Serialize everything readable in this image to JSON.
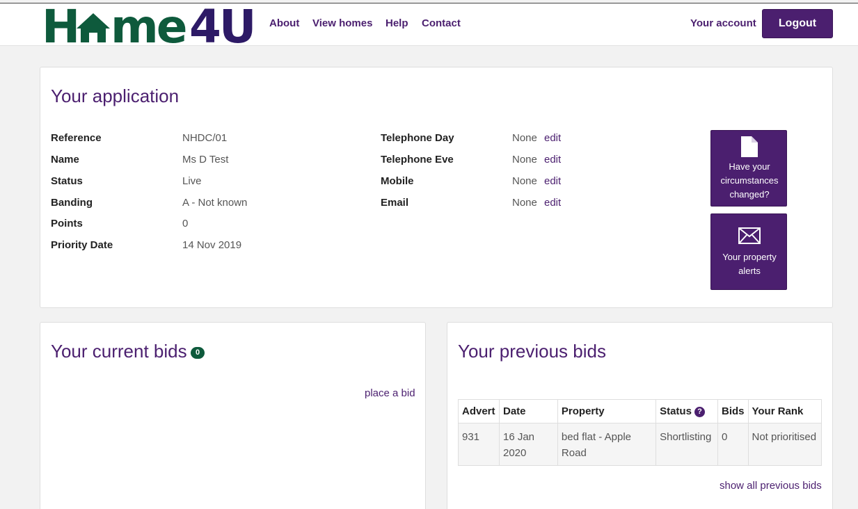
{
  "header": {
    "logo": {
      "part1": "H",
      "part2": "me",
      "part3": "4U",
      "colors": {
        "green": "#0e5a3c",
        "purple": "#4b1f6f"
      }
    },
    "nav": [
      "About",
      "View homes",
      "Help",
      "Contact"
    ],
    "account_label": "Your account",
    "logout_label": "Logout"
  },
  "application": {
    "title": "Your application",
    "details": [
      {
        "label": "Reference",
        "value": "NHDC/01"
      },
      {
        "label": "Name",
        "value": "Ms D Test"
      },
      {
        "label": "Status",
        "value": "Live"
      },
      {
        "label": "Banding",
        "value": "A - Not known"
      },
      {
        "label": "Points",
        "value": "0"
      },
      {
        "label": "Priority Date",
        "value": "14 Nov 2019"
      }
    ],
    "contacts": [
      {
        "label": "Telephone Day",
        "value": "None",
        "action": "edit"
      },
      {
        "label": "Telephone Eve",
        "value": "None",
        "action": "edit"
      },
      {
        "label": "Mobile",
        "value": "None",
        "action": "edit"
      },
      {
        "label": "Email",
        "value": "None",
        "action": "edit"
      }
    ],
    "tiles": [
      {
        "icon": "document-icon",
        "line1": "Have your",
        "line2": "circumstances",
        "line3": "changed?"
      },
      {
        "icon": "envelope-icon",
        "line1": "Your property",
        "line2": "alerts"
      }
    ]
  },
  "current_bids": {
    "title": "Your current bids",
    "count": "0",
    "action": "place a bid"
  },
  "previous_bids": {
    "title": "Your previous bids",
    "columns": [
      "Advert",
      "Date",
      "Property",
      "Status",
      "Bids",
      "Your Rank"
    ],
    "rows": [
      {
        "advert": "931",
        "date": "16 Jan 2020",
        "property": "bed flat - Apple Road",
        "status": "Shortlisting",
        "bids": "0",
        "rank": "Not prioritised"
      }
    ],
    "status_help_icon": "question-circle-icon",
    "show_all": "show all previous bids"
  },
  "colors": {
    "accent": "#4b1f6f",
    "brand_green": "#0e5a3c",
    "background": "#f2f2f2"
  }
}
